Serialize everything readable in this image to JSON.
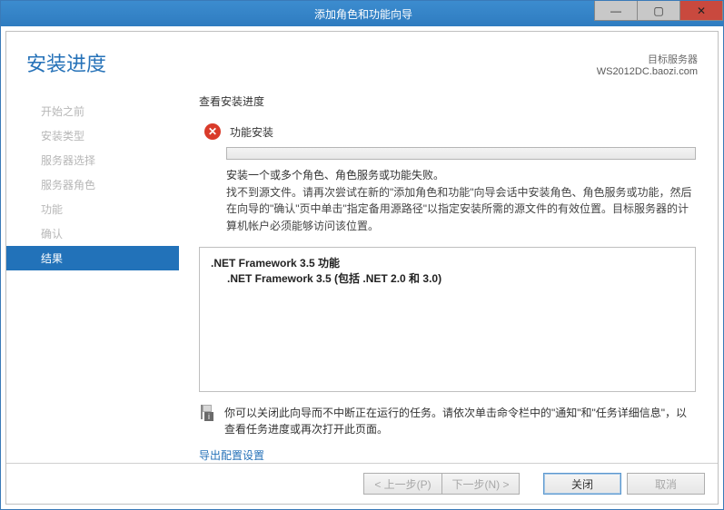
{
  "titlebar": {
    "title": "添加角色和功能向导"
  },
  "header": {
    "heading": "安装进度",
    "target_label": "目标服务器",
    "target_value": "WS2012DC.baozi.com"
  },
  "sidebar": {
    "steps": [
      {
        "label": "开始之前"
      },
      {
        "label": "安装类型"
      },
      {
        "label": "服务器选择"
      },
      {
        "label": "服务器角色"
      },
      {
        "label": "功能"
      },
      {
        "label": "确认"
      },
      {
        "label": "结果"
      }
    ]
  },
  "content": {
    "section_title": "查看安装进度",
    "status": "功能安装",
    "fail_line": "安装一个或多个角色、角色服务或功能失败。",
    "detail_text": "找不到源文件。请再次尝试在新的\"添加角色和功能\"向导会话中安装角色、角色服务或功能，然后在向导的\"确认\"页中单击\"指定备用源路径\"以指定安装所需的源文件的有效位置。目标服务器的计算机帐户必须能够访问该位置。",
    "result_line1": ".NET Framework 3.5 功能",
    "result_line2": ".NET Framework 3.5 (包括 .NET 2.0 和 3.0)",
    "info_text": "你可以关闭此向导而不中断正在运行的任务。请依次单击命令栏中的\"通知\"和\"任务详细信息\"，以查看任务进度或再次打开此页面。",
    "export_link": "导出配置设置"
  },
  "footer": {
    "prev": "< 上一步(P)",
    "next": "下一步(N) >",
    "close": "关闭",
    "cancel": "取消"
  }
}
